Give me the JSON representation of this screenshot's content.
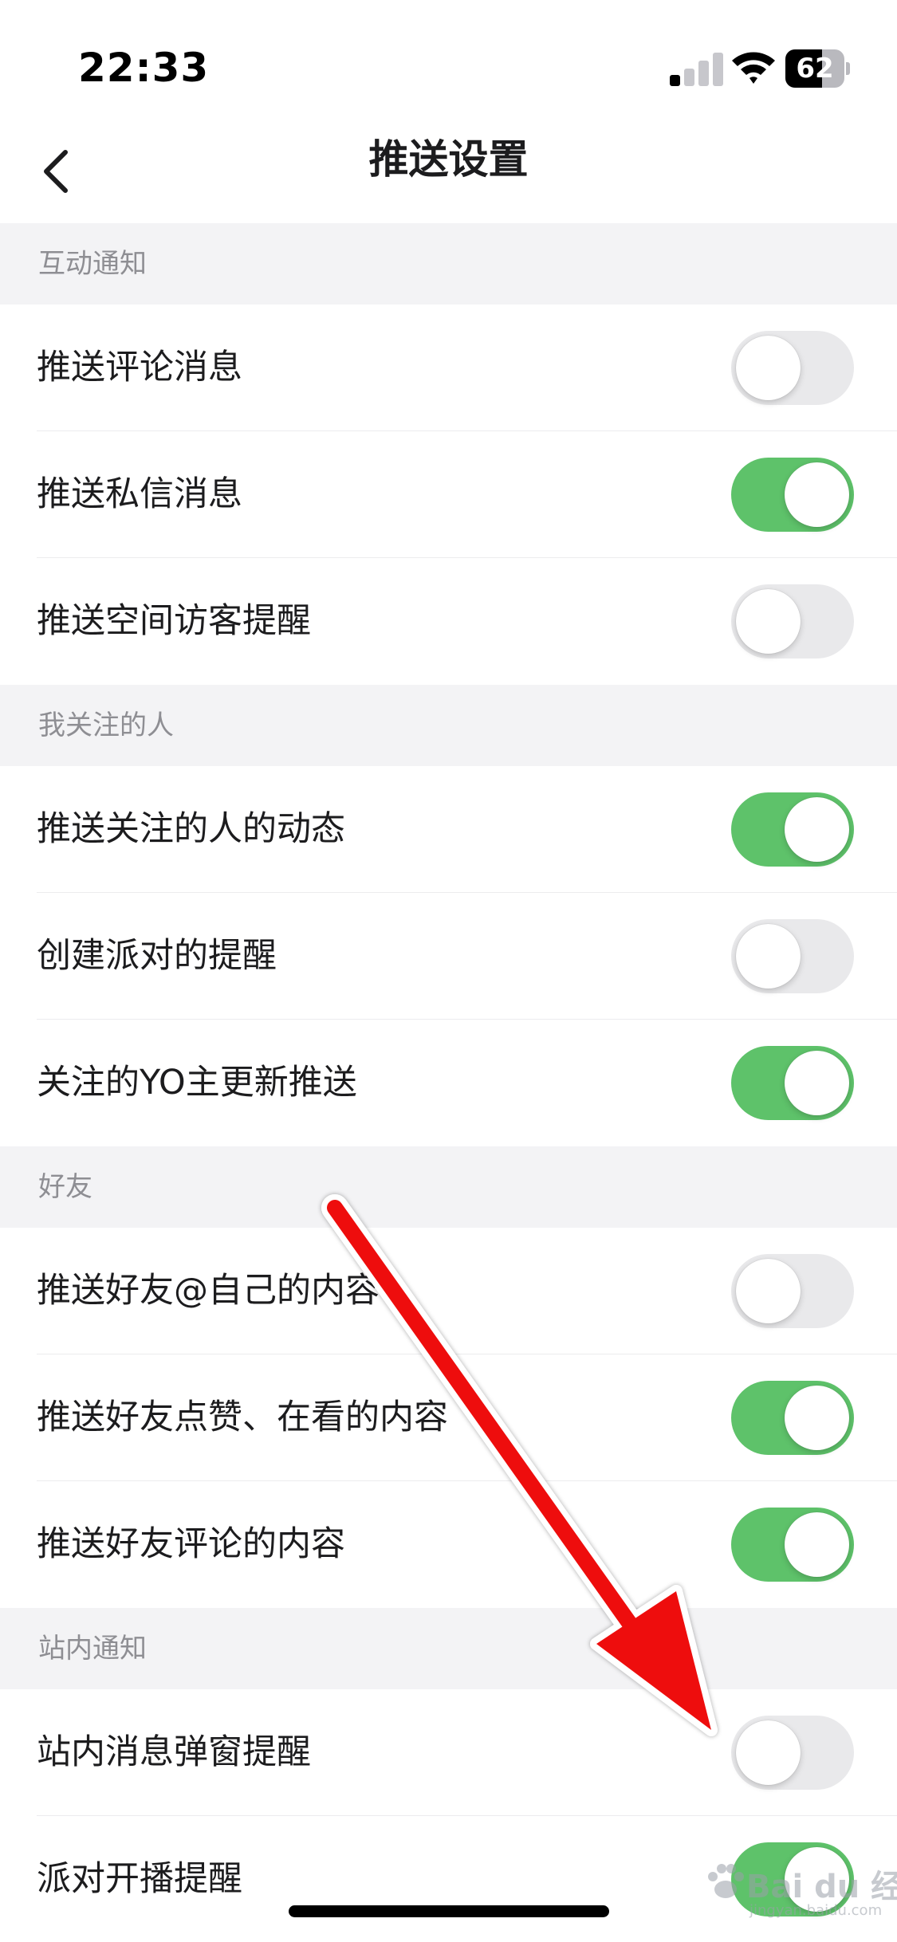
{
  "status_bar": {
    "time": "22:33",
    "battery_level": "62",
    "battery_fraction": 0.62,
    "signal_bars_on": 1,
    "icons": [
      "cellular-signal-icon",
      "wifi-icon",
      "battery-icon"
    ]
  },
  "nav": {
    "back_icon": "chevron-left-icon",
    "title": "推送设置"
  },
  "sections": [
    {
      "header": "互动通知",
      "items": [
        {
          "label": "推送评论消息",
          "on": false
        },
        {
          "label": "推送私信消息",
          "on": true
        },
        {
          "label": "推送空间访客提醒",
          "on": false
        }
      ]
    },
    {
      "header": "我关注的人",
      "items": [
        {
          "label": "推送关注的人的动态",
          "on": true
        },
        {
          "label": "创建派对的提醒",
          "on": false
        },
        {
          "label": "关注的YO主更新推送",
          "on": true
        }
      ]
    },
    {
      "header": "好友",
      "items": [
        {
          "label": "推送好友@自己的内容",
          "on": false
        },
        {
          "label": "推送好友点赞、在看的内容",
          "on": true
        },
        {
          "label": "推送好友评论的内容",
          "on": true
        }
      ]
    },
    {
      "header": "站内通知",
      "items": [
        {
          "label": "站内消息弹窗提醒",
          "on": false
        },
        {
          "label": "派对开播提醒",
          "on": true
        }
      ]
    }
  ],
  "annotation": {
    "type": "red-arrow",
    "color": "#ee1111",
    "points_to": "站内消息弹窗提醒"
  },
  "watermark": {
    "text": "Bai du 经验",
    "sub": "jingyan.baidu.com"
  },
  "colors": {
    "toggle_on": "#5ec26a",
    "toggle_off": "#e9e9eb",
    "section_background": "#f3f3f5",
    "section_header_text": "#8e8e93"
  }
}
